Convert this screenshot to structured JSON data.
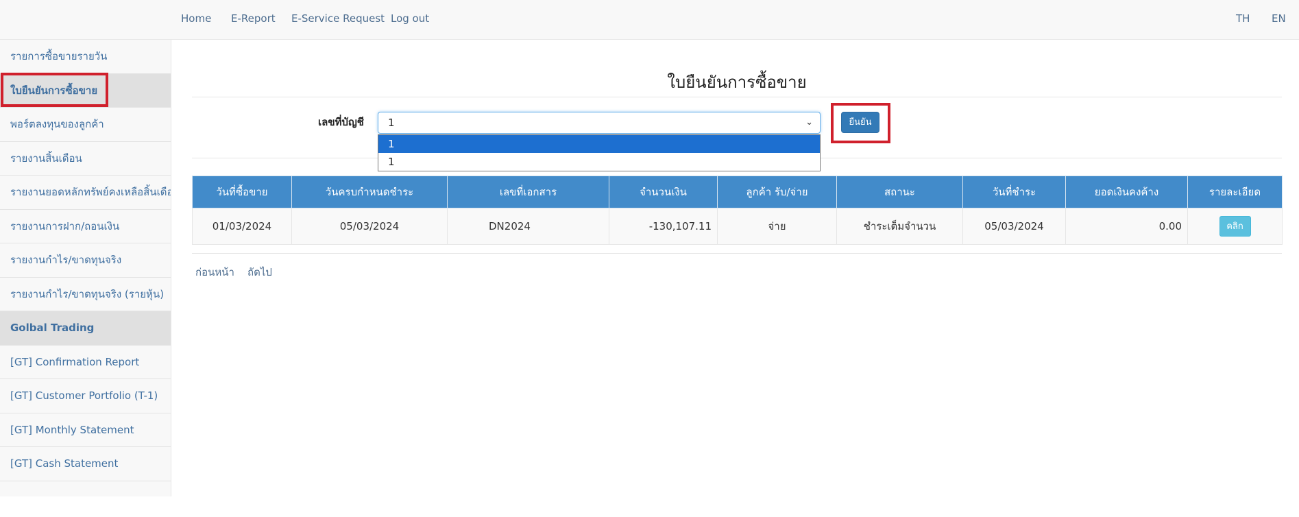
{
  "topnav": {
    "links": [
      "Home",
      "E-Report",
      "E-Service Request",
      "Log out"
    ],
    "lang_th": "TH",
    "lang_en": "EN"
  },
  "sidebar": {
    "items": [
      "รายการซื้อขายรายวัน",
      "ใบยืนยันการซื้อขาย",
      "พอร์ตลงทุนของลูกค้า",
      "รายงานสิ้นเดือน",
      "รายงานยอดหลักทรัพย์คงเหลือสิ้นเดือน",
      "รายงานการฝาก/ถอนเงิน",
      "รายงานกำไร/ขาดทุนจริง",
      "รายงานกำไร/ขาดทุนจริง (รายหุ้น)",
      "Golbal Trading",
      "[GT] Confirmation Report",
      "[GT] Customer Portfolio (T-1)",
      "[GT] Monthly Statement",
      "[GT] Cash Statement"
    ]
  },
  "main": {
    "title": "ใบยืนยันการซื้อขาย",
    "account_label": "เลขที่บัญชี",
    "account_value": "1",
    "account_options": [
      "1",
      "1"
    ],
    "confirm_label": "ยืนยัน",
    "table": {
      "headers": [
        "วันที่ซื้อขาย",
        "วันครบกำหนดชำระ",
        "เลขที่เอกสาร",
        "จำนวนเงิน",
        "ลูกค้า รับ/จ่าย",
        "สถานะ",
        "วันที่ชำระ",
        "ยอดเงินคงค้าง",
        "รายละเอียด"
      ],
      "rows": [
        {
          "trade_date": "01/03/2024",
          "due_date": "05/03/2024",
          "doc_no": "DN2024",
          "amount": "-130,107.11",
          "receive_pay": "จ่าย",
          "status": "ชำระเต็มจำนวน",
          "paid_date": "05/03/2024",
          "outstanding": "0.00",
          "detail_button": "คลิก"
        }
      ]
    },
    "pager": {
      "prev": "ก่อนหน้า",
      "next": "ถัดไป"
    }
  },
  "colors": {
    "highlight": "#d0202c",
    "header_blue": "#428bca",
    "button_blue": "#337ab7",
    "button_info": "#5bc0de",
    "dropdown_selected": "#1d6fd0"
  }
}
